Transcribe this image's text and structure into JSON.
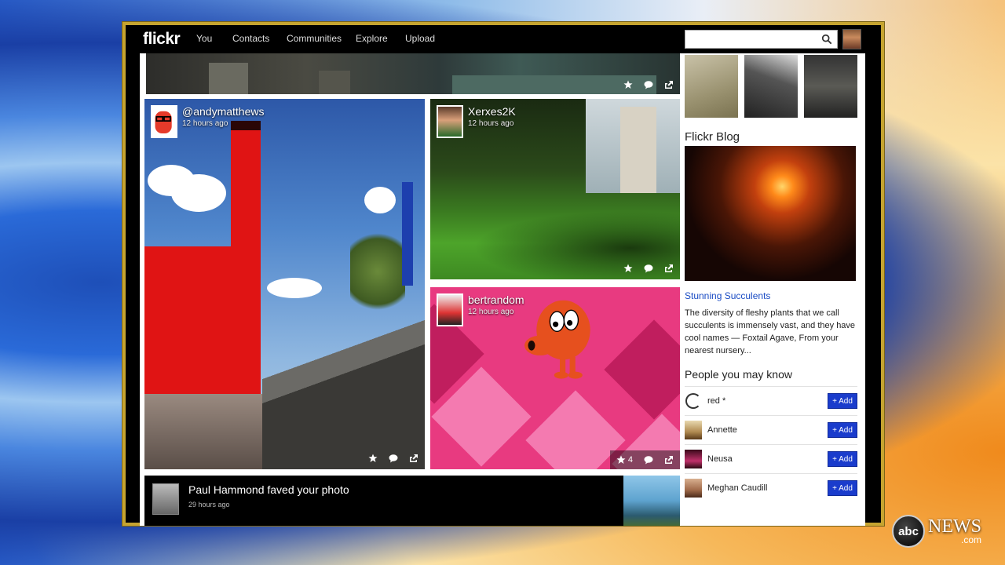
{
  "app": {
    "logo": "flickr"
  },
  "nav": {
    "items": [
      "You",
      "Contacts",
      "Communities",
      "Explore",
      "Upload"
    ]
  },
  "search": {
    "value": "",
    "placeholder": ""
  },
  "feed": {
    "cards": [
      {
        "username": "@andymatthews",
        "time": "12 hours ago"
      },
      {
        "username": "Xerxes2K",
        "time": "12 hours ago"
      },
      {
        "username": "bertrandom",
        "time": "12 hours ago",
        "fave_count": "4"
      }
    ],
    "activity": {
      "message": "Paul Hammond faved your photo",
      "time": "29 hours ago"
    }
  },
  "sidebar": {
    "blog_title": "Flickr Blog",
    "blog_post_title": "Stunning Succulents",
    "blog_post_desc": "The diversity of fleshy plants that we call succulents is immensely vast, and they have cool names — Foxtail Agave, From your nearest nursery...",
    "people_title": "People you may know",
    "people": [
      {
        "name": "red *",
        "button": "+ Add"
      },
      {
        "name": "Annette",
        "button": "+ Add"
      },
      {
        "name": "Neusa",
        "button": "+ Add"
      },
      {
        "name": "Meghan Caudill",
        "button": "+ Add"
      }
    ]
  },
  "broadcast": {
    "logo_text": "abc",
    "brand": "NEWS",
    "suffix": ".com"
  },
  "colors": {
    "accent": "#1a3ccc",
    "frame": "#c6a430",
    "link": "#1a4cc4"
  }
}
